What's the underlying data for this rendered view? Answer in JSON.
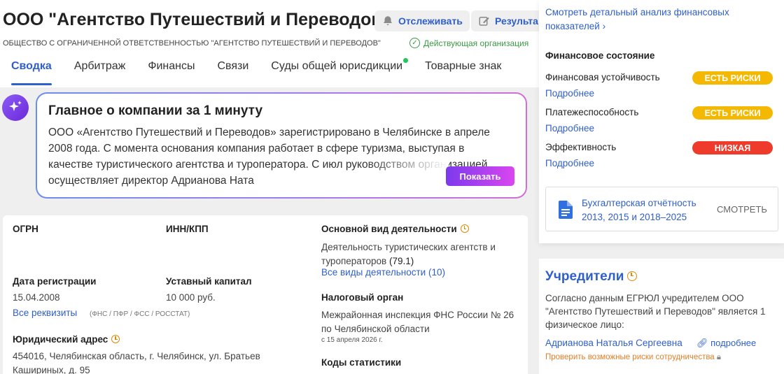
{
  "header": {
    "title": "ООО \"Агентство Путешествий и Переводов\"",
    "track_label": "Отслеживать",
    "results_label": "Результа",
    "full_name": "ОБЩЕСТВО С ОГРАНИЧЕННОЙ ОТВЕТСТВЕННОСТЬЮ \"АГЕНТСТВО ПУТЕШЕСТВИЙ И ПЕРЕВОДОВ\"",
    "status": "Действующая организация"
  },
  "tabs": [
    {
      "label": "Сводка",
      "active": true
    },
    {
      "label": "Арбитраж"
    },
    {
      "label": "Финансы"
    },
    {
      "label": "Связи"
    },
    {
      "label": "Суды общей юрисдикции",
      "dot": true
    },
    {
      "label": "Товарные знак"
    }
  ],
  "summary": {
    "title": "Главное о компании за 1 минуту",
    "text": "ООО «Агентство Путешествий и Переводов» зарегистрировано в Челябинске в апреле 2008 года. С момента основания компания работает в сфере туризма, выступая в качестве туристического агентства и туроператора. С июл руководством организацией осуществляет директор Адрианова Ната",
    "button": "Показать"
  },
  "details": {
    "ogrn_label": "ОГРН",
    "inn_label": "ИНН/КПП",
    "activity_label": "Основной вид деятельности",
    "activity_value": "Деятельность туристических агентств и туроператоров",
    "activity_code": "(79.1)",
    "activity_link": "Все виды деятельности (10)",
    "reg_date_label": "Дата регистрации",
    "reg_date_value": "15.04.2008",
    "capital_label": "Уставный капитал",
    "capital_value": "10 000 руб.",
    "requisites_link": "Все реквизиты",
    "requisites_note": "(ФНС / ПФР / ФСС / РОССТАТ)",
    "tax_label": "Налоговый орган",
    "tax_value": "Межрайонная инспекция ФНС России № 26 по Челябинской области",
    "tax_date": "с 15 апреля 2026 г.",
    "address_label": "Юридический адрес",
    "address_value": "454016, Челябинская область, г. Челябинск, ул. Братьев Кашириных, д. 95",
    "stats_label": "Коды статистики"
  },
  "finance": {
    "analysis_link": "Смотреть детальный анализ финансовых показателей",
    "heading": "Финансовое состояние",
    "rows": [
      {
        "label": "Финансовая устойчивость",
        "badge": "ЕСТЬ РИСКИ",
        "more": "Подробнее"
      },
      {
        "label": "Платежеспособность",
        "badge": "ЕСТЬ РИСКИ",
        "more": "Подробнее"
      },
      {
        "label": "Эффективность",
        "badge": "НИЗКАЯ",
        "more": "Подробнее"
      }
    ],
    "report_text": "Бухгалтерская отчётность 2013, 2015 и 2018–2025",
    "report_button": "СМОТРЕТЬ",
    "colors": {
      "risk": "#f5b800",
      "low": "#ee3b2b",
      "accent": "#2f5fc9"
    }
  },
  "founders": {
    "title": "Учредители",
    "text": "Согласно данным ЕГРЮЛ учредителем ООО \"Агентство Путешествий и Переводов\" является 1 физическое лицо:",
    "name": "Адрианова Наталья Сергеевна",
    "more": "подробнее",
    "check": "Проверить возможные риски сотрудничества"
  }
}
